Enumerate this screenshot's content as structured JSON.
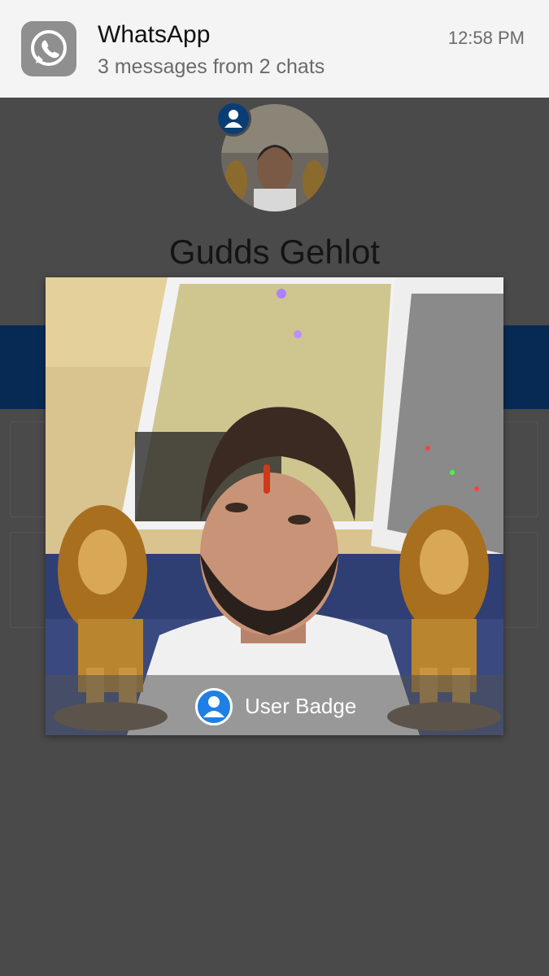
{
  "notification": {
    "app_name": "WhatsApp",
    "message": "3 messages from 2 chats",
    "time": "12:58 PM",
    "icon": "whatsapp-icon"
  },
  "profile": {
    "name": "Gudds Gehlot",
    "avatar_icon": "avatar",
    "badge_icon": "user-badge-icon"
  },
  "popup": {
    "image": "profile-photo",
    "badge_label": "User Badge",
    "badge_icon": "user-badge-icon"
  },
  "colors": {
    "overlay": "#4a4a4a",
    "blue_band": "#072a55",
    "badge_blue": "#1e7fe6"
  }
}
